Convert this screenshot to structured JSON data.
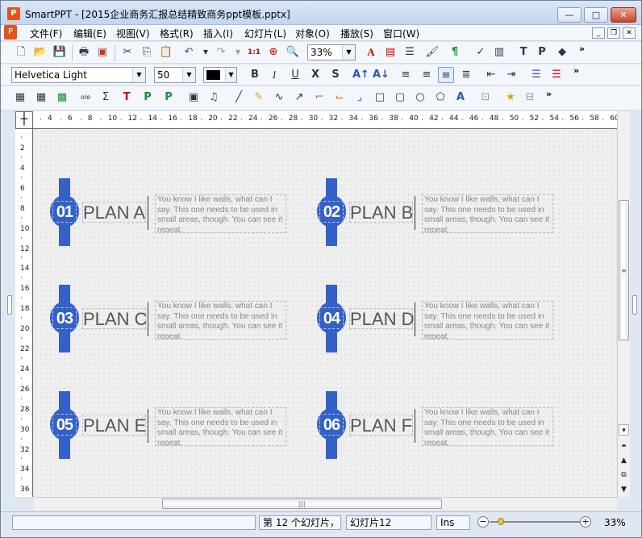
{
  "window": {
    "app_name": "SmartPPT",
    "title": "SmartPPT - [2015企业商务汇报总结精致商务ppt模板.pptx]",
    "controls": {
      "minimize": "—",
      "maximize": "□",
      "close": "✕"
    }
  },
  "menu": {
    "items": [
      "文件(F)",
      "编辑(E)",
      "视图(V)",
      "格式(R)",
      "插入(I)",
      "幻灯片(L)",
      "对象(O)",
      "播放(S)",
      "窗口(W)"
    ],
    "mdi": {
      "minimize": "_",
      "restore": "❐",
      "close": "✕"
    }
  },
  "toolbar1": {
    "zoom": "33%"
  },
  "toolbar2": {
    "font": "Helvetica Light",
    "size": "50",
    "color": "#000000"
  },
  "ruler": {
    "h_ticks": [
      "4",
      "6",
      "8",
      "10",
      "12",
      "14",
      "16",
      "18",
      "20",
      "22",
      "24",
      "26",
      "28",
      "30",
      "32",
      "34",
      "36",
      "38",
      "40",
      "42",
      "44",
      "46",
      "48",
      "50",
      "52",
      "54",
      "56",
      "58",
      "60"
    ],
    "v_ticks": [
      "2",
      "4",
      "6",
      "8",
      "10",
      "12",
      "14",
      "16",
      "18",
      "20",
      "22",
      "24",
      "26",
      "28",
      "30",
      "32",
      "34",
      "36"
    ]
  },
  "slide": {
    "accent": "#3461c8",
    "plans": [
      {
        "num": "01",
        "title": "PLAN A",
        "text": "You know I like walls, what can I say. This one needs to be used in small areas, though. You can see it repeat."
      },
      {
        "num": "02",
        "title": "PLAN B",
        "text": "You know I like walls, what can I say. This one needs to be used in small areas, though. You can see it repeat."
      },
      {
        "num": "03",
        "title": "PLAN C",
        "text": "You know I like walls, what can I say. This one needs to be used in small areas, though. You can see it repeat."
      },
      {
        "num": "04",
        "title": "PLAN D",
        "text": "You know I like walls, what can I say. This one needs to be used in small areas, though. You can see it repeat."
      },
      {
        "num": "05",
        "title": "PLAN E",
        "text": "You know I like walls, what can I say. This one needs to be used in small areas, though. You can see it repeat."
      },
      {
        "num": "06",
        "title": "PLAN F",
        "text": "You know I like walls, what can I say. This one needs to be used in small areas, though. You can see it repeat."
      }
    ]
  },
  "status": {
    "slide_count": "第 12 个幻灯片，",
    "current_slide": "幻灯片12",
    "mode": "Ins",
    "zoom": "33%",
    "zoom_out": "−",
    "zoom_in": "+"
  }
}
